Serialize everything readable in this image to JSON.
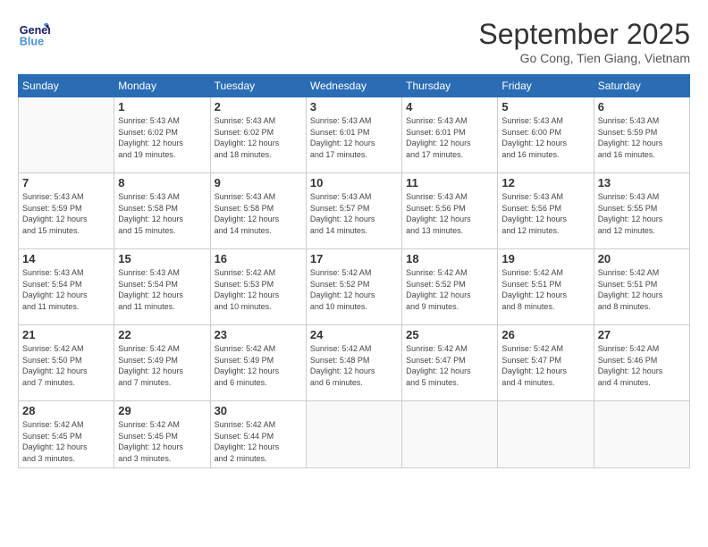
{
  "header": {
    "logo_general": "General",
    "logo_blue": "Blue",
    "title": "September 2025",
    "location": "Go Cong, Tien Giang, Vietnam"
  },
  "weekdays": [
    "Sunday",
    "Monday",
    "Tuesday",
    "Wednesday",
    "Thursday",
    "Friday",
    "Saturday"
  ],
  "weeks": [
    [
      {
        "day": "",
        "info": ""
      },
      {
        "day": "1",
        "info": "Sunrise: 5:43 AM\nSunset: 6:02 PM\nDaylight: 12 hours\nand 19 minutes."
      },
      {
        "day": "2",
        "info": "Sunrise: 5:43 AM\nSunset: 6:02 PM\nDaylight: 12 hours\nand 18 minutes."
      },
      {
        "day": "3",
        "info": "Sunrise: 5:43 AM\nSunset: 6:01 PM\nDaylight: 12 hours\nand 17 minutes."
      },
      {
        "day": "4",
        "info": "Sunrise: 5:43 AM\nSunset: 6:01 PM\nDaylight: 12 hours\nand 17 minutes."
      },
      {
        "day": "5",
        "info": "Sunrise: 5:43 AM\nSunset: 6:00 PM\nDaylight: 12 hours\nand 16 minutes."
      },
      {
        "day": "6",
        "info": "Sunrise: 5:43 AM\nSunset: 5:59 PM\nDaylight: 12 hours\nand 16 minutes."
      }
    ],
    [
      {
        "day": "7",
        "info": "Sunrise: 5:43 AM\nSunset: 5:59 PM\nDaylight: 12 hours\nand 15 minutes."
      },
      {
        "day": "8",
        "info": "Sunrise: 5:43 AM\nSunset: 5:58 PM\nDaylight: 12 hours\nand 15 minutes."
      },
      {
        "day": "9",
        "info": "Sunrise: 5:43 AM\nSunset: 5:58 PM\nDaylight: 12 hours\nand 14 minutes."
      },
      {
        "day": "10",
        "info": "Sunrise: 5:43 AM\nSunset: 5:57 PM\nDaylight: 12 hours\nand 14 minutes."
      },
      {
        "day": "11",
        "info": "Sunrise: 5:43 AM\nSunset: 5:56 PM\nDaylight: 12 hours\nand 13 minutes."
      },
      {
        "day": "12",
        "info": "Sunrise: 5:43 AM\nSunset: 5:56 PM\nDaylight: 12 hours\nand 12 minutes."
      },
      {
        "day": "13",
        "info": "Sunrise: 5:43 AM\nSunset: 5:55 PM\nDaylight: 12 hours\nand 12 minutes."
      }
    ],
    [
      {
        "day": "14",
        "info": "Sunrise: 5:43 AM\nSunset: 5:54 PM\nDaylight: 12 hours\nand 11 minutes."
      },
      {
        "day": "15",
        "info": "Sunrise: 5:43 AM\nSunset: 5:54 PM\nDaylight: 12 hours\nand 11 minutes."
      },
      {
        "day": "16",
        "info": "Sunrise: 5:42 AM\nSunset: 5:53 PM\nDaylight: 12 hours\nand 10 minutes."
      },
      {
        "day": "17",
        "info": "Sunrise: 5:42 AM\nSunset: 5:52 PM\nDaylight: 12 hours\nand 10 minutes."
      },
      {
        "day": "18",
        "info": "Sunrise: 5:42 AM\nSunset: 5:52 PM\nDaylight: 12 hours\nand 9 minutes."
      },
      {
        "day": "19",
        "info": "Sunrise: 5:42 AM\nSunset: 5:51 PM\nDaylight: 12 hours\nand 8 minutes."
      },
      {
        "day": "20",
        "info": "Sunrise: 5:42 AM\nSunset: 5:51 PM\nDaylight: 12 hours\nand 8 minutes."
      }
    ],
    [
      {
        "day": "21",
        "info": "Sunrise: 5:42 AM\nSunset: 5:50 PM\nDaylight: 12 hours\nand 7 minutes."
      },
      {
        "day": "22",
        "info": "Sunrise: 5:42 AM\nSunset: 5:49 PM\nDaylight: 12 hours\nand 7 minutes."
      },
      {
        "day": "23",
        "info": "Sunrise: 5:42 AM\nSunset: 5:49 PM\nDaylight: 12 hours\nand 6 minutes."
      },
      {
        "day": "24",
        "info": "Sunrise: 5:42 AM\nSunset: 5:48 PM\nDaylight: 12 hours\nand 6 minutes."
      },
      {
        "day": "25",
        "info": "Sunrise: 5:42 AM\nSunset: 5:47 PM\nDaylight: 12 hours\nand 5 minutes."
      },
      {
        "day": "26",
        "info": "Sunrise: 5:42 AM\nSunset: 5:47 PM\nDaylight: 12 hours\nand 4 minutes."
      },
      {
        "day": "27",
        "info": "Sunrise: 5:42 AM\nSunset: 5:46 PM\nDaylight: 12 hours\nand 4 minutes."
      }
    ],
    [
      {
        "day": "28",
        "info": "Sunrise: 5:42 AM\nSunset: 5:45 PM\nDaylight: 12 hours\nand 3 minutes."
      },
      {
        "day": "29",
        "info": "Sunrise: 5:42 AM\nSunset: 5:45 PM\nDaylight: 12 hours\nand 3 minutes."
      },
      {
        "day": "30",
        "info": "Sunrise: 5:42 AM\nSunset: 5:44 PM\nDaylight: 12 hours\nand 2 minutes."
      },
      {
        "day": "",
        "info": ""
      },
      {
        "day": "",
        "info": ""
      },
      {
        "day": "",
        "info": ""
      },
      {
        "day": "",
        "info": ""
      }
    ]
  ]
}
